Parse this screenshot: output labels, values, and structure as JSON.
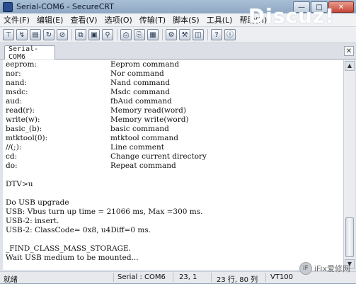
{
  "window": {
    "title": "Serial-COM6 - SecureCRT"
  },
  "watermark": "Discuz!",
  "menubar": {
    "items": [
      {
        "label": "文件(F)"
      },
      {
        "label": "编辑(E)"
      },
      {
        "label": "查看(V)"
      },
      {
        "label": "选项(O)"
      },
      {
        "label": "传输(T)"
      },
      {
        "label": "脚本(S)"
      },
      {
        "label": "工具(L)"
      },
      {
        "label": "帮助(H)"
      }
    ]
  },
  "toolbar": {
    "icons": [
      "connect-icon",
      "quick-connect-icon",
      "connect-tab-icon",
      "reconnect-icon",
      "disconnect-icon",
      "copy-icon",
      "paste-icon",
      "find-icon",
      "print-icon",
      "print-setup-icon",
      "map-icon",
      "session-options-icon",
      "global-options-icon",
      "sftp-icon",
      "help-icon",
      "about-icon"
    ]
  },
  "tabs": [
    {
      "label": "Serial-COM6"
    }
  ],
  "terminal": {
    "commands": [
      {
        "cmd": "eeprom:",
        "desc": "Eeprom command"
      },
      {
        "cmd": "nor:",
        "desc": "Nor command"
      },
      {
        "cmd": "nand:",
        "desc": "Nand command"
      },
      {
        "cmd": "msdc:",
        "desc": "Msdc command"
      },
      {
        "cmd": "aud:",
        "desc": "fbAud command"
      },
      {
        "cmd": "read(r):",
        "desc": "Memory read(word)"
      },
      {
        "cmd": "write(w):",
        "desc": "Memory write(word)"
      },
      {
        "cmd": "basic_(b):",
        "desc": "basic command"
      },
      {
        "cmd": "mtktool(0):",
        "desc": "mtktool command"
      },
      {
        "cmd": "//(;):",
        "desc": "Line comment"
      },
      {
        "cmd": "cd:",
        "desc": "Change current directory"
      },
      {
        "cmd": "do:",
        "desc": "Repeat command"
      }
    ],
    "prompt": "DTV>u",
    "output": [
      "Do USB upgrade",
      "USB: Vbus turn up time = 21066 ms, Max =300 ms.",
      "USB-2: insert.",
      "USB-2: ClassCode= 0x8, u4Diff=0 ms."
    ],
    "output2": [
      "_FIND_CLASS_MASS_STORAGE.",
      "Wait USB medium to be mounted..."
    ]
  },
  "statusbar": {
    "ready": "就绪",
    "connection": "Serial : COM6",
    "cursor_pos": "23,  1",
    "size": "23 行, 80 列",
    "emulation": "VT100"
  },
  "brand": {
    "logo_text": "iF",
    "text": "iFix爱修网"
  }
}
